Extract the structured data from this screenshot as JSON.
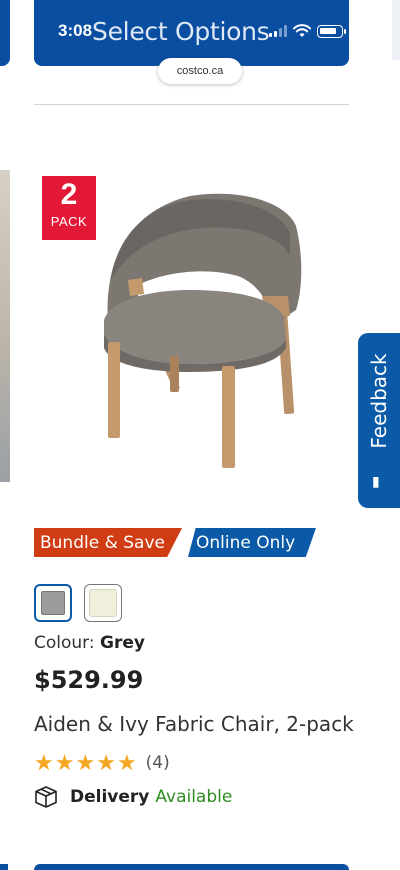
{
  "status_bar": {
    "time": "3:08"
  },
  "header": {
    "title": "Select Options"
  },
  "browser": {
    "url": "costco.ca"
  },
  "product": {
    "pack_badge": {
      "number": "2",
      "label": "PACK"
    },
    "badges": {
      "bundle": "Bundle & Save",
      "online": "Online Only"
    },
    "swatches": [
      {
        "name": "Grey",
        "color": "#9b9b9b",
        "selected": true
      },
      {
        "name": "Cream",
        "color": "#efefdc",
        "selected": false
      }
    ],
    "colour_label": "Colour:",
    "colour_value": "Grey",
    "price": "$529.99",
    "name": "Aiden & Ivy Fabric Chair, 2-pack",
    "rating": {
      "stars": 5,
      "count": "(4)"
    },
    "delivery": {
      "label": "Delivery",
      "status": "Available"
    }
  },
  "feedback": {
    "label": "Feedback"
  },
  "colors": {
    "brand_blue": "#0a4ea2",
    "accent_red": "#e31837",
    "bundle_orange": "#d03c13",
    "success_green": "#2e8b20",
    "star_gold": "#f5a623"
  },
  "icons": [
    "wifi-icon",
    "cellular-signal-icon",
    "battery-icon",
    "delivery-box-icon",
    "star-icon",
    "feedback-icon"
  ]
}
